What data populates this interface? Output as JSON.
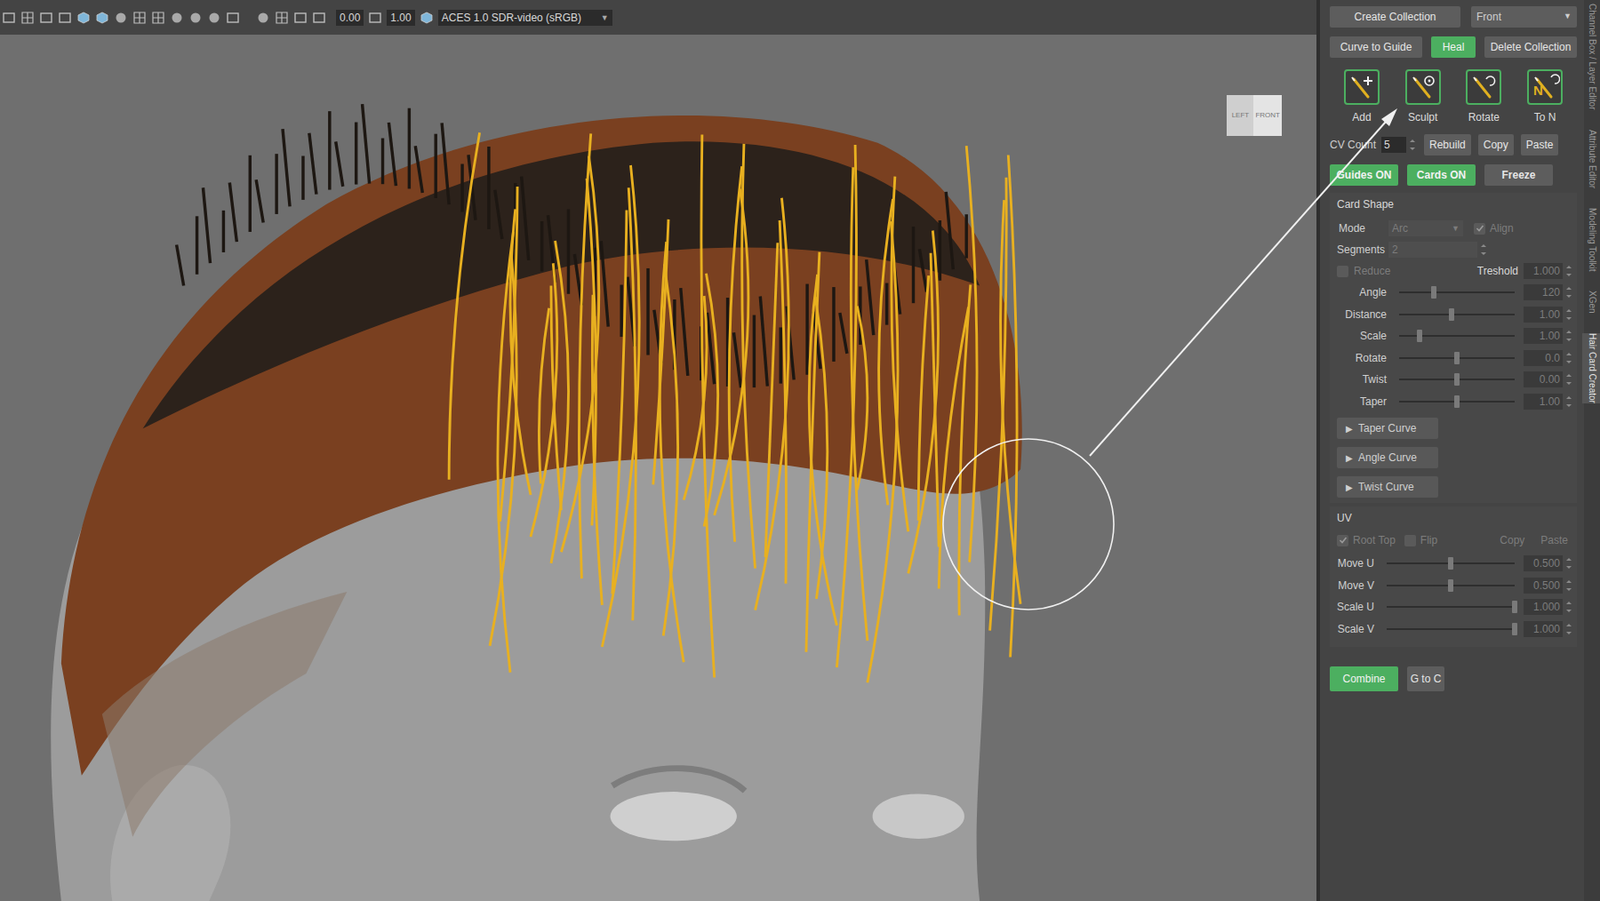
{
  "toolbar": {
    "exposure": "0.00",
    "gamma": "1.00",
    "color_space": "ACES 1.0 SDR-video (sRGB)",
    "dropdown_glyph": "▼"
  },
  "viewport": {
    "view_cube": [
      "LEFT",
      "FRONT"
    ]
  },
  "collection_row": {
    "create": "Create Collection",
    "view": "Front",
    "dropdown_glyph": "▼"
  },
  "action_buttons": [
    {
      "label": "Curve to Guide",
      "active": false
    },
    {
      "label": "Heal",
      "active": true
    },
    {
      "label": "Delete Collection",
      "active": false
    }
  ],
  "tools": [
    {
      "label": "Add",
      "icon_text": "",
      "kind": "add"
    },
    {
      "label": "Sculpt",
      "icon_text": "",
      "kind": "sculpt"
    },
    {
      "label": "Rotate",
      "icon_text": "",
      "kind": "rotate"
    },
    {
      "label": "To N",
      "icon_text": "N",
      "kind": "ton"
    }
  ],
  "cv": {
    "label": "CV Count",
    "value": "5",
    "buttons": [
      "Rebuild",
      "Copy",
      "Paste"
    ]
  },
  "toggles": [
    {
      "label": "Guides ON",
      "active": true
    },
    {
      "label": "Cards ON",
      "active": true
    },
    {
      "label": "Freeze",
      "active": false
    }
  ],
  "card_shape": {
    "title": "Card Shape",
    "mode": {
      "label": "Mode",
      "value": "Arc",
      "disabled": true
    },
    "align": {
      "label": "Align",
      "checked": true,
      "disabled": true
    },
    "segments": {
      "label": "Segments",
      "value": "2",
      "disabled": true
    },
    "reduce": {
      "label": "Reduce",
      "checked": false,
      "disabled": true
    },
    "threshold": {
      "label": "Treshold",
      "value": "1.000",
      "disabled": true
    },
    "sliders": [
      {
        "label": "Angle",
        "value": "120",
        "level": 0.3,
        "disabled": true
      },
      {
        "label": "Distance",
        "value": "1.00",
        "level": 0.45,
        "disabled": true
      },
      {
        "label": "Scale",
        "value": "1.00",
        "level": 0.18,
        "disabled": true
      },
      {
        "label": "Rotate",
        "value": "0.0",
        "level": 0.5,
        "disabled": true
      },
      {
        "label": "Twist",
        "value": "0.00",
        "level": 0.5,
        "disabled": true
      },
      {
        "label": "Taper",
        "value": "1.00",
        "level": 0.5,
        "disabled": true
      }
    ],
    "curves": [
      {
        "label": "Taper Curve",
        "glyph": "▶",
        "expanded": false
      },
      {
        "label": "Angle Curve",
        "glyph": "▶",
        "expanded": false
      },
      {
        "label": "Twist Curve",
        "glyph": "▶",
        "expanded": false
      }
    ]
  },
  "uv": {
    "title": "UV",
    "root_top": {
      "label": "Root Top",
      "checked": true,
      "disabled": true
    },
    "flip": {
      "label": "Flip",
      "checked": false,
      "disabled": true
    },
    "copy": "Copy",
    "paste": "Paste",
    "sliders": [
      {
        "label": "Move U",
        "value": "0.500",
        "level": 0.5,
        "disabled": true
      },
      {
        "label": "Move V",
        "value": "0.500",
        "level": 0.5,
        "disabled": true
      },
      {
        "label": "Scale U",
        "value": "1.000",
        "level": 1.0,
        "disabled": true
      },
      {
        "label": "Scale V",
        "value": "1.000",
        "level": 1.0,
        "disabled": true
      }
    ]
  },
  "bottom_buttons": [
    {
      "label": "Combine",
      "active": true
    },
    {
      "label": "G to C",
      "active": false
    }
  ],
  "side_tabs": [
    {
      "label": "Channel Box / Layer Editor",
      "selected": false
    },
    {
      "label": "Attribute Editor",
      "selected": false
    },
    {
      "label": "Modeling Toolkit",
      "selected": false
    },
    {
      "label": "XGen",
      "selected": false
    },
    {
      "label": "Hair Card Creator",
      "selected": true
    }
  ]
}
